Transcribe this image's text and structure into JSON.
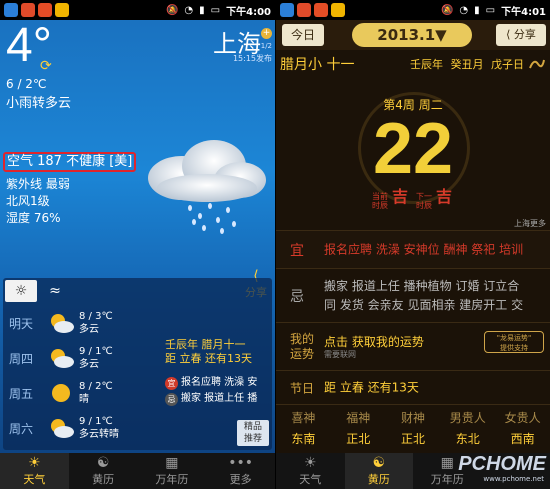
{
  "left": {
    "status": {
      "time": "下午4:00"
    },
    "weather": {
      "temp": "4°",
      "city": "上海",
      "page_indicator": "1/2",
      "publish_time": "15:15发布",
      "range": "6 / 2℃",
      "condition": "小雨转多云",
      "aqi": "空气 187 不健康 [美]",
      "uv": "紫外线 最弱",
      "wind": "北风1级",
      "humidity": "湿度 76%",
      "share": "分享"
    },
    "forecast": [
      {
        "day": "明天",
        "temp": "8 / 3℃",
        "cond": "多云",
        "icon": "cloudy-sun-icon"
      },
      {
        "day": "周四",
        "temp": "9 / 1℃",
        "cond": "多云",
        "icon": "cloudy-sun-icon"
      },
      {
        "day": "周五",
        "temp": "8 / 2℃",
        "cond": "晴",
        "icon": "sun-icon"
      },
      {
        "day": "周六",
        "temp": "9 / 1℃",
        "cond": "多云转晴",
        "icon": "cloudy-sun-icon"
      }
    ],
    "lunar": {
      "line1": "壬辰年 腊月十一",
      "line2": "距 立春 还有13天",
      "yi_badge": "宜",
      "yi": "报名应聘 洗澡 安",
      "ji_badge": "忌",
      "ji": "搬家 报道上任 播"
    },
    "jingpin": {
      "l1": "精品",
      "l2": "推荐"
    },
    "nav": [
      "天气",
      "黄历",
      "万年历",
      "更多"
    ]
  },
  "right": {
    "status": {
      "time": "下午4:01"
    },
    "today_btn": "今日",
    "date": "2013.1▼",
    "share_btn": "分享",
    "lunar_date": "腊月小 十一",
    "ganzhi": "壬辰年 癸丑月 戊子日",
    "week": "第4周 周二",
    "day": "22",
    "sc1": {
      "a": "当前",
      "b": "时辰",
      "v": "吉"
    },
    "sc2": {
      "a": "下一",
      "b": "时辰",
      "v": "吉"
    },
    "more": "上海更多",
    "yi": {
      "label": "宜",
      "text": "报名应聘 洗澡 安神位 酬神 祭祀 培训"
    },
    "ji": {
      "label": "忌",
      "line1": "搬家 报道上任 播种植物 订婚 订立合",
      "line2": "同 发货 会亲友 见面相亲 建房开工 交"
    },
    "yun": {
      "l1": "我的",
      "l2": "运势",
      "t1": "点击 获取我的运势",
      "t2": "需要联网",
      "tag1": "\"龙易运势\"",
      "tag2": "提供支持"
    },
    "jieqi": {
      "label": "节日",
      "text": "距 立春 还有13天"
    },
    "gods": [
      {
        "n": "喜神",
        "d": "东南"
      },
      {
        "n": "福神",
        "d": "正北"
      },
      {
        "n": "财神",
        "d": "正北"
      },
      {
        "n": "男贵人",
        "d": "东北"
      },
      {
        "n": "女贵人",
        "d": "西南"
      }
    ],
    "nav": [
      "天气",
      "黄历",
      "万年历"
    ],
    "watermark": "PCHOME",
    "watermark_url": "www.pchome.net"
  }
}
